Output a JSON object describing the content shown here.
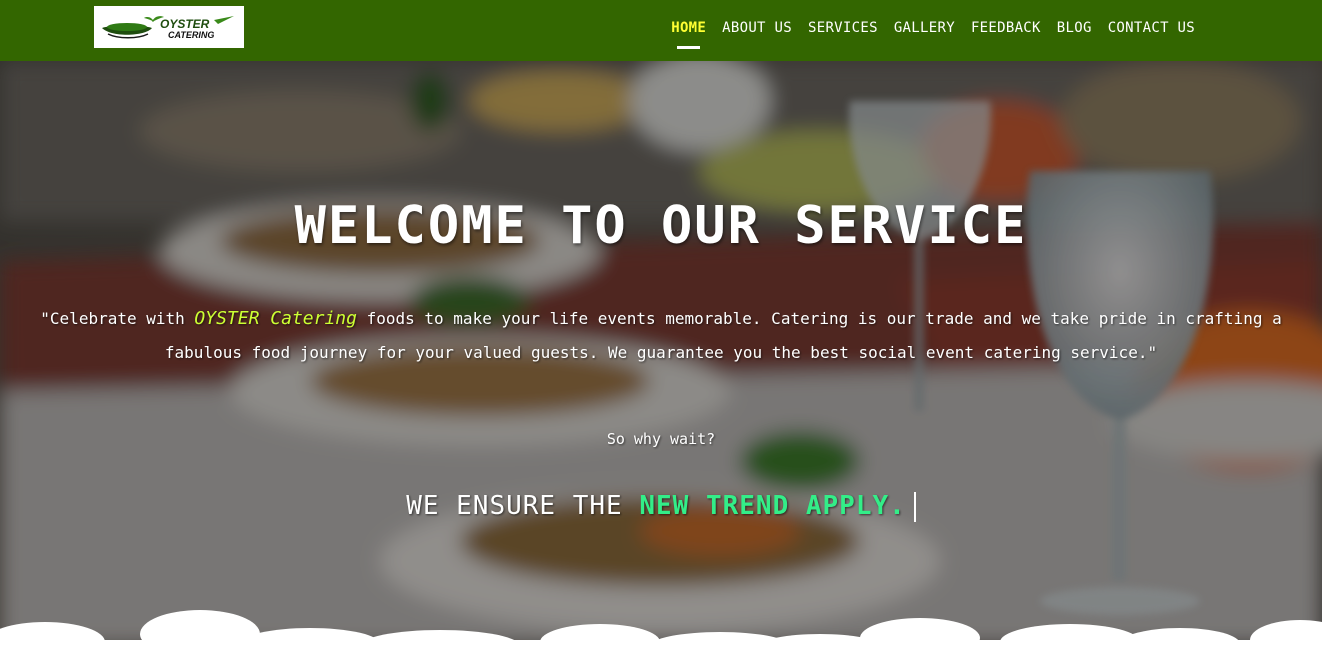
{
  "brand": {
    "logo_line1": "OYSTER",
    "logo_line2": "CATERING"
  },
  "nav": {
    "items": [
      {
        "label": "HOME",
        "active": true
      },
      {
        "label": "ABOUT US",
        "active": false
      },
      {
        "label": "SERVICES",
        "active": false
      },
      {
        "label": "GALLERY",
        "active": false
      },
      {
        "label": "FEEDBACK",
        "active": false
      },
      {
        "label": "BLOG",
        "active": false
      },
      {
        "label": "CONTACT US",
        "active": false
      }
    ]
  },
  "hero": {
    "title": "WELCOME TO OUR SERVICE",
    "quote_open": "\"Celebrate with ",
    "quote_brand": "OYSTER Catering",
    "quote_rest": " foods to make your life events memorable. Catering is our trade and we take pride in crafting a fabulous food journey for your valued guests. We guarantee you the best social event catering service.\"",
    "question": "So why wait?",
    "tagline_prefix": "WE ENSURE THE ",
    "tagline_accent": "NEW TREND APPLY."
  },
  "colors": {
    "navbar": "#336600",
    "active_nav": "#ffff33",
    "brand_highlight": "#ccff33",
    "tagline_accent": "#33ee88"
  }
}
